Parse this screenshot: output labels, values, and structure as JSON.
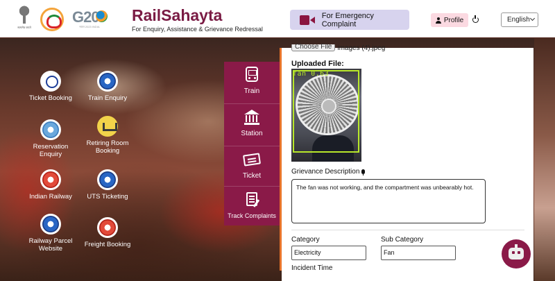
{
  "header": {
    "emblem_text": "सत्यमेव जयते",
    "g20_text": "G20",
    "g20_sub": "भारत 2023 INDIA",
    "title": "RailSahayta",
    "subtitle": "For Enquiry, Assistance & Grievance Redressal",
    "emergency_label": "For Emergency Complaint",
    "profile_label": "Profile",
    "language": "English"
  },
  "services": [
    {
      "label": "Ticket Booking",
      "icon": "ticket-booking-icon"
    },
    {
      "label": "Train Enquiry",
      "icon": "train-enquiry-icon"
    },
    {
      "label": "Reservation Enquiry",
      "icon": "reservation-enquiry-icon"
    },
    {
      "label": "Retiring Room Booking",
      "icon": "retiring-room-icon"
    },
    {
      "label": "Indian Railway",
      "icon": "indian-railway-icon"
    },
    {
      "label": "UTS Ticketing",
      "icon": "uts-ticketing-icon"
    },
    {
      "label": "Railway Parcel Website",
      "icon": "railway-parcel-icon"
    },
    {
      "label": "Freight Booking",
      "icon": "freight-booking-icon"
    }
  ],
  "tabs": [
    {
      "label": "Train",
      "icon": "train-icon",
      "active": true
    },
    {
      "label": "Station",
      "icon": "station-icon",
      "active": false
    },
    {
      "label": "Ticket",
      "icon": "ticket-icon",
      "active": false
    },
    {
      "label": "Track Complaints",
      "icon": "track-complaints-icon",
      "active": false
    }
  ],
  "form": {
    "choose_file_label": "Choose File",
    "file_name": "images (4).jpeg",
    "uploaded_file_label": "Uploaded File:",
    "detection_label": "fan  0.63",
    "description_label": "Grievance Description",
    "description_value": "The fan was not working, and the compartment was unbearably hot.",
    "category_label": "Category",
    "category_value": "Electricity",
    "subcategory_label": "Sub Category",
    "subcategory_value": "Fan",
    "incident_time_label": "Incident Time"
  },
  "colors": {
    "brand": "#7a1b44",
    "tab_bg": "#8a1a48",
    "accent": "#e8742a",
    "emergency_bg": "#d7d3ee",
    "profile_bg": "#fbd9e1",
    "detection_box": "#b8e82a"
  }
}
